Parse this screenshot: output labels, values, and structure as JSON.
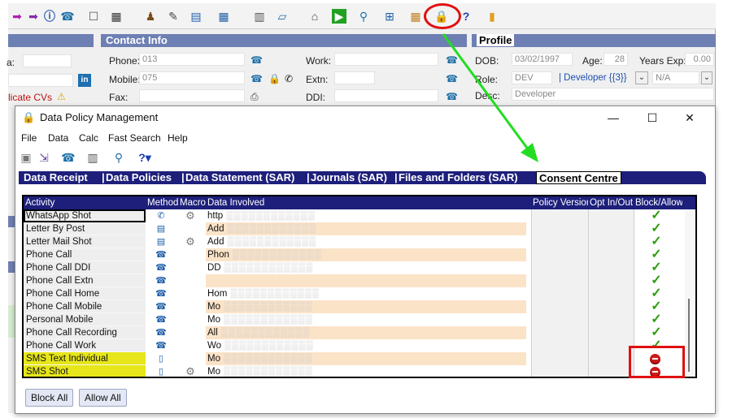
{
  "background": {
    "contact_header": "Contact Info",
    "profile_header": "Profile",
    "left_partial": {
      "field_label": "a:",
      "dupe_text": "licate CVs"
    },
    "contact": {
      "phone_label": "Phone:",
      "phone_value": "013",
      "mobile_label": "Mobile:",
      "mobile_value": "075",
      "fax_label": "Fax:",
      "work_label": "Work:",
      "extn_label": "Extn:",
      "ddi_label": "DDI:"
    },
    "profile": {
      "dob_label": "DOB:",
      "dob_value": "03/02/1997",
      "age_label": "Age:",
      "age_value": "28",
      "years_exp_label": "Years Exp:",
      "years_exp_value": "0.00",
      "role_label": "Role:",
      "role_value": "DEV",
      "role_desc": "| Developer {{3}}",
      "na_value": "N/A",
      "desc_label": "Desc:",
      "desc_value": "Developer"
    }
  },
  "dialog": {
    "title": "Data Policy Management",
    "window_controls": {
      "minimize": "—",
      "maximize": "☐",
      "close": "✕"
    },
    "menu": [
      "File",
      "Data",
      "Calc",
      "Fast Search",
      "Help"
    ],
    "tabs": [
      "Data Receipt",
      "Data Policies",
      "Data Statement (SAR)",
      "Journals (SAR)",
      "Files and Folders (SAR)",
      "Consent Centre"
    ],
    "active_tab": "Consent Centre",
    "columns": [
      "Activity",
      "Method",
      "Macro",
      "Data Involved",
      "Policy Version",
      "Opt In/Out",
      "Block/Allow"
    ],
    "rows": [
      {
        "activity": "WhatsApp Shot",
        "method": "whatsapp-icon",
        "macro": true,
        "data": "http",
        "status": "allow",
        "selected": true,
        "highlight": false,
        "shaded": false
      },
      {
        "activity": "Letter By Post",
        "method": "document-icon",
        "macro": false,
        "data": "Add",
        "status": "allow",
        "selected": false,
        "highlight": false,
        "shaded": true
      },
      {
        "activity": "Letter Mail Shot",
        "method": "document-icon",
        "macro": true,
        "data": "Add",
        "status": "allow",
        "selected": false,
        "highlight": false,
        "shaded": false
      },
      {
        "activity": "Phone Call",
        "method": "phone-icon",
        "macro": false,
        "data": "Phon",
        "status": "allow",
        "selected": false,
        "highlight": false,
        "shaded": true
      },
      {
        "activity": "Phone Call DDI",
        "method": "phone-icon",
        "macro": false,
        "data": "DD",
        "status": "allow",
        "selected": false,
        "highlight": false,
        "shaded": false
      },
      {
        "activity": "Phone Call Extn",
        "method": "phone-icon",
        "macro": false,
        "data": "",
        "status": "allow",
        "selected": false,
        "highlight": false,
        "shaded": true
      },
      {
        "activity": "Phone Call Home",
        "method": "phone-icon",
        "macro": false,
        "data": "Hom",
        "status": "allow",
        "selected": false,
        "highlight": false,
        "shaded": false
      },
      {
        "activity": "Phone Call Mobile",
        "method": "phone-icon",
        "macro": false,
        "data": "Mo",
        "status": "allow",
        "selected": false,
        "highlight": false,
        "shaded": true
      },
      {
        "activity": "Personal Mobile",
        "method": "phone-icon",
        "macro": false,
        "data": "Mo",
        "status": "allow",
        "selected": false,
        "highlight": false,
        "shaded": false
      },
      {
        "activity": "Phone Call Recording",
        "method": "phone-icon",
        "macro": false,
        "data": "All",
        "status": "allow",
        "selected": false,
        "highlight": false,
        "shaded": true
      },
      {
        "activity": "Phone Call Work",
        "method": "phone-icon",
        "macro": false,
        "data": "Wo",
        "status": "allow",
        "selected": false,
        "highlight": false,
        "shaded": false
      },
      {
        "activity": "SMS Text Individual",
        "method": "mobile-icon",
        "macro": false,
        "data": "Mo",
        "status": "block",
        "selected": false,
        "highlight": true,
        "shaded": true
      },
      {
        "activity": "SMS Shot",
        "method": "mobile-icon",
        "macro": true,
        "data": "Mo",
        "status": "block",
        "selected": false,
        "highlight": true,
        "shaded": false
      }
    ],
    "buttons": {
      "block_all": "Block All",
      "allow_all": "Allow All"
    }
  },
  "colors": {
    "tab_bar": "#1d1f7b",
    "highlight": "#e6e61a",
    "annotation": "#e01010",
    "arrow": "#22dd22",
    "allow": "#2e9e12",
    "block": "#cc1a1a"
  }
}
